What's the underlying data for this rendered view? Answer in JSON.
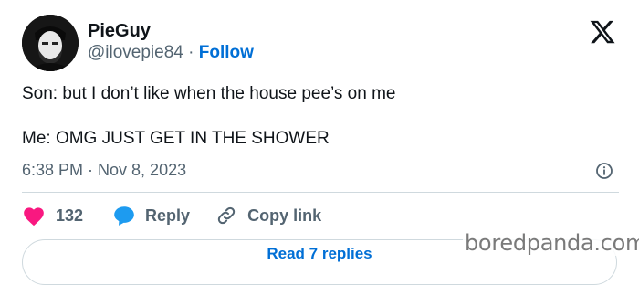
{
  "author": {
    "display_name": "PieGuy",
    "handle": "@ilovepie84",
    "separator": "·",
    "follow_label": "Follow"
  },
  "tweet": {
    "line1": "Son: but I don’t like when the house pee’s on me",
    "line2": "Me: OMG JUST GET IN THE SHOWER",
    "timestamp": "6:38 PM · Nov 8, 2023"
  },
  "actions": {
    "likes_count": "132",
    "reply_label": "Reply",
    "copy_link_label": "Copy link"
  },
  "read_replies_label": "Read 7 replies",
  "watermark": "boredpanda.com",
  "icons": {
    "heart": "heart-icon",
    "reply": "speech-bubble-icon",
    "link": "link-icon",
    "info": "info-icon",
    "logo": "x-logo-icon"
  },
  "colors": {
    "heart": "#f91880",
    "reply_bubble": "#1d9bf0",
    "follow": "#006fd6",
    "secondary_text": "#536471"
  }
}
